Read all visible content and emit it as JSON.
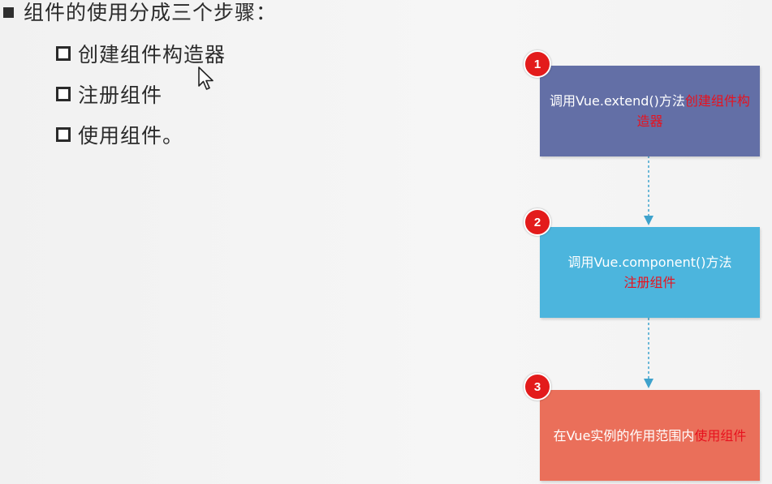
{
  "slide": {
    "heading": "组件的使用分成三个步骤：",
    "steps": [
      "创建组件构造器",
      "注册组件",
      "使用组件。"
    ]
  },
  "flowchart": {
    "boxes": [
      {
        "number": "1",
        "text_plain": "调用Vue.extend()方法",
        "text_highlight": "创建组件构造器",
        "color": "#636fa6"
      },
      {
        "number": "2",
        "text_plain": "调用Vue.component()方法",
        "text_highlight": "注册组件",
        "color": "#4cb5dd"
      },
      {
        "number": "3",
        "text_plain": "在Vue实例的作用范围内",
        "text_highlight": "使用组件",
        "color": "#ea6f5a"
      }
    ],
    "highlight_color": "#e8121e",
    "badge_color": "#e31b1b",
    "connector_color": "#4aa9d0"
  }
}
